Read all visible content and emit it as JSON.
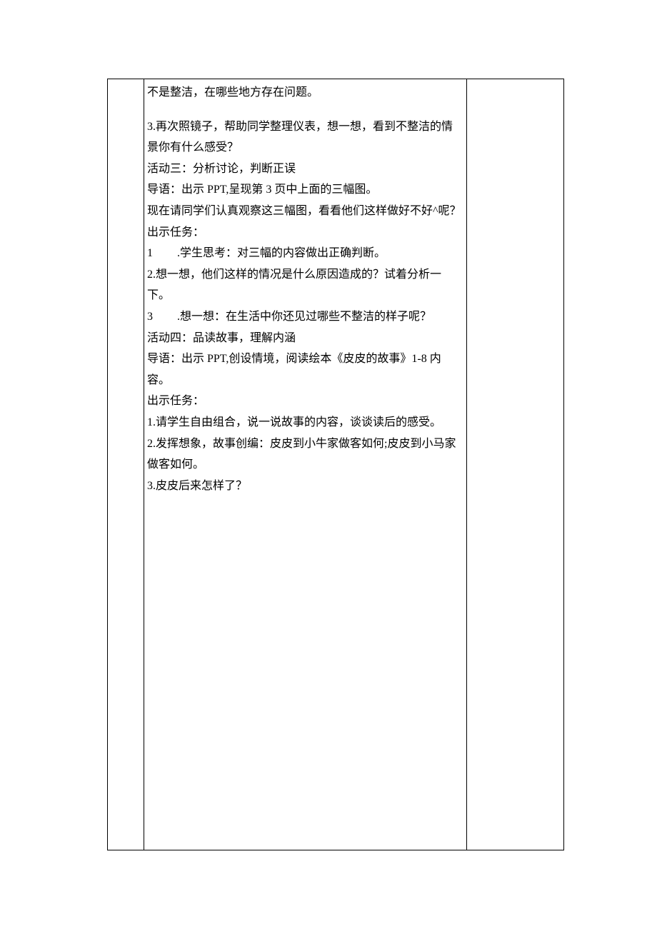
{
  "doc": {
    "line0": "不是整洁，在哪些地方存在问题。",
    "line1": "3.再次照镜子，帮助同学整理仪表，想一想，看到不整洁的情景你有什么感受？",
    "line2": "活动三：分析讨论，判断正误",
    "line3": "导语：出示 PPT,呈现第 3 页中上面的三幅图。",
    "line4": "现在请同学们认真观察这三幅图，看看他们这样做好不好^呢？",
    "line5": "出示任务：",
    "line6_num": "1",
    "line6_rest": ".学生思考：对三幅的内容做出正确判断。",
    "line7": "2.想一想，他们这样的情况是什么原因造成的？试着分析一下。",
    "line8_num": "3",
    "line8_rest": ".想一想：在生活中你还见过哪些不整洁的样子呢？",
    "line9": "活动四：品读故事，理解内涵",
    "line10": "导语：出示 PPT,创设情境，阅读绘本《皮皮的故事》1-8 内容。",
    "line11": "出示任务：",
    "line12": "1.请学生自由组合，说一说故事的内容，谈谈读后的感受。",
    "line13": "2.发挥想象，故事创编：皮皮到小牛家做客如何;皮皮到小马家做客如何。",
    "line14": "3.皮皮后来怎样了？"
  }
}
